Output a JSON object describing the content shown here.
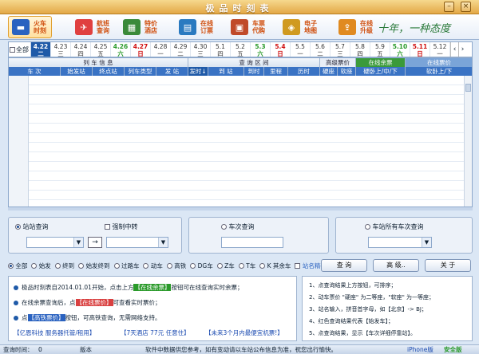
{
  "window": {
    "title": "极品时刻表"
  },
  "toolbar": {
    "items": [
      {
        "label": "火车时刻",
        "icon": "train-icon"
      },
      {
        "label": "航班查询",
        "icon": "plane-icon"
      },
      {
        "label": "特价酒店",
        "icon": "hotel-icon"
      },
      {
        "label": "在线订票",
        "icon": "ticket-icon"
      },
      {
        "label": "车票代购",
        "icon": "bus-icon"
      },
      {
        "label": "电子地图",
        "icon": "map-icon"
      },
      {
        "label": "在线升级",
        "icon": "upgrade-icon"
      }
    ],
    "slogan": "十年，一种态度"
  },
  "dates": {
    "all_label": "全部",
    "items": [
      {
        "date": "4.22",
        "day": "二"
      },
      {
        "date": "4.23",
        "day": "三"
      },
      {
        "date": "4.24",
        "day": "四"
      },
      {
        "date": "4.25",
        "day": "五"
      },
      {
        "date": "4.26",
        "day": "六"
      },
      {
        "date": "4.27",
        "day": "日"
      },
      {
        "date": "4.28",
        "day": "一"
      },
      {
        "date": "4.29",
        "day": "二"
      },
      {
        "date": "4.30",
        "day": "三"
      },
      {
        "date": "5.1",
        "day": "四"
      },
      {
        "date": "5.2",
        "day": "五"
      },
      {
        "date": "5.3",
        "day": "六"
      },
      {
        "date": "5.4",
        "day": "日"
      },
      {
        "date": "5.5",
        "day": "一"
      },
      {
        "date": "5.6",
        "day": "二"
      },
      {
        "date": "5.7",
        "day": "三"
      },
      {
        "date": "5.8",
        "day": "四"
      },
      {
        "date": "5.9",
        "day": "五"
      },
      {
        "date": "5.10",
        "day": "六"
      },
      {
        "date": "5.11",
        "day": "日"
      },
      {
        "date": "5.12",
        "day": "一"
      }
    ]
  },
  "grid": {
    "group_headers": [
      "列 车 信 息",
      "查 询 区 间",
      "高级票价",
      "在线余票",
      "在线票价"
    ],
    "columns": [
      "车 次",
      "始发站",
      "终点站",
      "列车类型",
      "发 站",
      "发时↓",
      "到 站",
      "到时",
      "里程",
      "历时",
      "硬座",
      "软座",
      "硬卧上/中/下",
      "软卧上/下"
    ]
  },
  "query": {
    "station_query": "站站查询",
    "force_transfer": "强制中转",
    "arrow": "→",
    "train_query": "车次查询",
    "station_all_trains": "车站所有车次查询"
  },
  "filters": {
    "options": [
      "全部",
      "始发",
      "终到",
      "始发终到",
      "过路车",
      "动车",
      "高铁",
      "DG车",
      "Z车",
      "T车",
      "K 其余车"
    ],
    "exact_match": "站名精确匹配"
  },
  "buttons": {
    "query": "查 询",
    "advanced": "高 级..",
    "about": "关 于"
  },
  "info": {
    "line1_pre": "极品时刻表自2014.01.01开始，点击上方",
    "line1_hl": "【在线余票】",
    "line1_post": "按钮可在线查询实时余票；",
    "line2_pre": "在线余票查询后，点",
    "line2_hl": "【在线票价】",
    "line2_post": "可查看实时票价；",
    "line3_pre": "点",
    "line3_hl": "【高铁票价】",
    "line3_post": "按钮，可高铁查询，无需网络支持。",
    "link1": "【亿恩科技 服务器托管/租用】",
    "link2": "【7天酒店 77元 任意住】",
    "link3": "【未来3个月内最便宜机票!】"
  },
  "help": {
    "line1": "1、点查询结果上方按钮，可排序；",
    "line2": "2、动车票价 \"硬座\" 为二等座，\"软座\" 为一等座；",
    "line3": "3、站名输入，拼音首字母，如【北京】-> BJ；",
    "line4": "4、红色查询结果代表【始发车】；",
    "line5": "5、点查询结果，显示【车次详细停靠站】。"
  },
  "status": {
    "query_time_label": "查询时间：",
    "query_time_value": "0",
    "version_label": "版本",
    "notice": "软件中数据供您参考，如有变动请以车站公布信息为准，祝您出行愉快。",
    "iphone": "iPhone版",
    "security": "安全版"
  },
  "colors": {
    "accent": "#1f5aa8",
    "header_blue": "#3a73c4",
    "highlight_green": "#2a9a2a",
    "highlight_red": "#d94040",
    "title_gold": "#e3a847"
  }
}
